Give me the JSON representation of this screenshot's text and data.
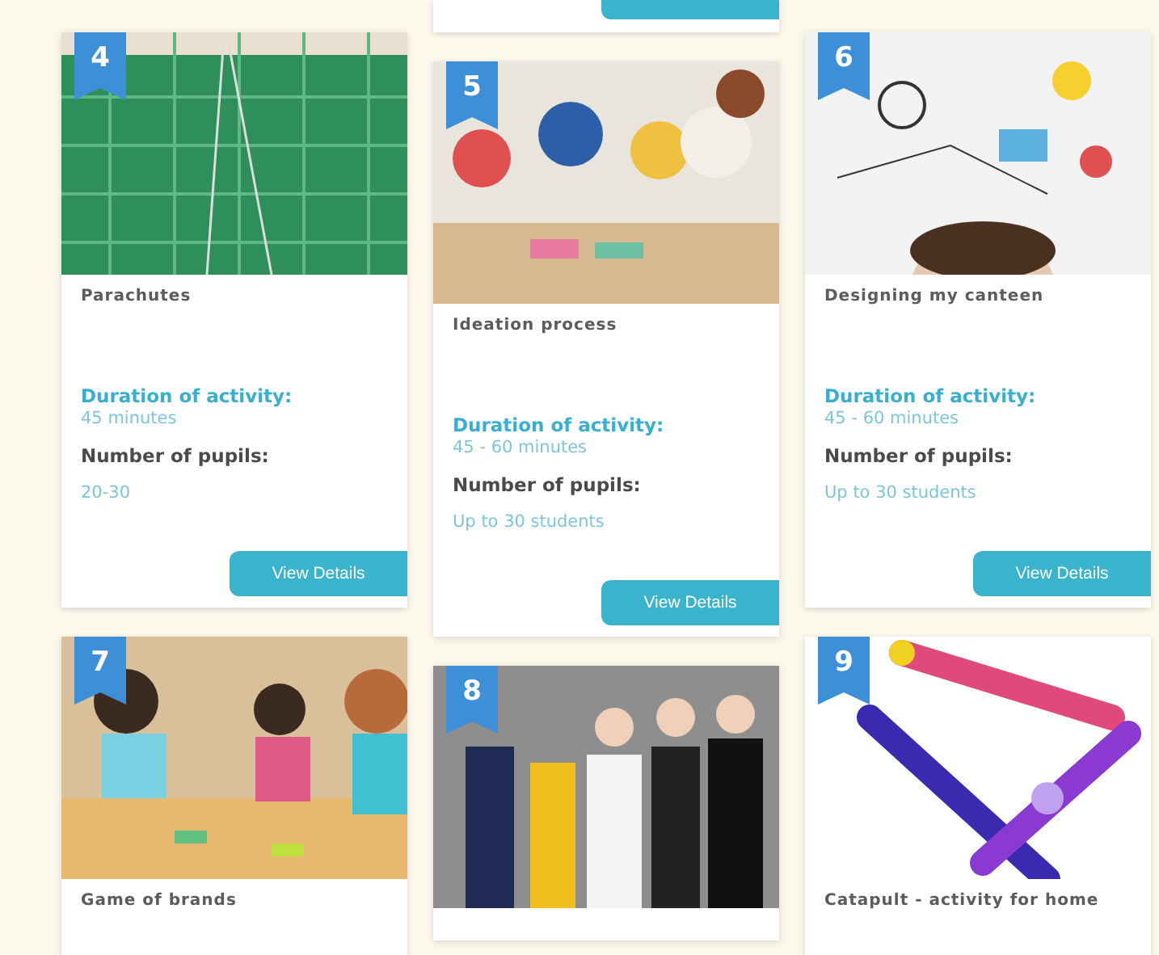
{
  "columns": [
    {
      "cards": [
        {
          "number": "4",
          "title": "Parachutes",
          "kind": "picture",
          "duration_label": "Duration of activity:",
          "duration": "45 minutes",
          "pupils_label": "Number of pupils:",
          "pupils": "20-30",
          "button": "View Details"
        },
        {
          "number": "7",
          "title": "Game of brands",
          "kind": "picture"
        }
      ]
    },
    {
      "stub": true,
      "cards": [
        {
          "number": "5",
          "title": "Ideation process",
          "kind": "picture",
          "duration_label": "Duration of activity:",
          "duration": "45 - 60 minutes",
          "pupils_label": "Number of pupils:",
          "pupils": "Up to 30 students",
          "button": "View Details"
        },
        {
          "number": "8",
          "kind": "picture"
        }
      ]
    },
    {
      "cards": [
        {
          "number": "6",
          "title": "Designing my canteen",
          "kind": "picture",
          "duration_label": "Duration of activity:",
          "duration": "45 - 60 minutes",
          "pupils_label": "Number of pupils:",
          "pupils": "Up to 30 students",
          "button": "View Details"
        },
        {
          "number": "9",
          "title": "Catapult - activity for home",
          "kind": "picture"
        }
      ]
    }
  ]
}
